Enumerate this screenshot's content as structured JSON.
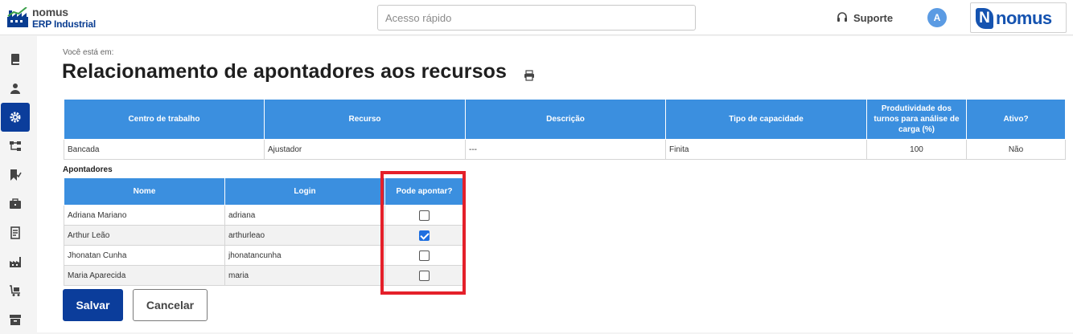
{
  "brand": {
    "name": "nomus",
    "subtitle": "ERP Industrial",
    "logo_text": "nomus"
  },
  "header": {
    "quick_access_placeholder": "Acesso rápido",
    "support_label": "Suporte",
    "avatar_initial": "A"
  },
  "sidebar": {
    "items": [
      {
        "icon": "book-icon"
      },
      {
        "icon": "user-icon"
      },
      {
        "icon": "gear-icon",
        "active": true
      },
      {
        "icon": "flow-icon"
      },
      {
        "icon": "bookmark-check-icon"
      },
      {
        "icon": "briefcase-icon"
      },
      {
        "icon": "document-icon"
      },
      {
        "icon": "factory-icon"
      },
      {
        "icon": "cart-icon"
      },
      {
        "icon": "archive-icon"
      }
    ]
  },
  "page": {
    "breadcrumb": "Você está em:",
    "title": "Relacionamento de apontadores aos recursos"
  },
  "resource_table": {
    "headers": [
      "Centro de trabalho",
      "Recurso",
      "Descrição",
      "Tipo de capacidade",
      "Produtividade dos turnos para análise de carga (%)",
      "Ativo?"
    ],
    "row": [
      "Bancada",
      "Ajustador",
      "---",
      "Finita",
      "100",
      "Não"
    ]
  },
  "pointers": {
    "section_label": "Apontadores",
    "headers": [
      "Nome",
      "Login",
      "Pode apontar?"
    ],
    "rows": [
      {
        "name": "Adriana Mariano",
        "login": "adriana",
        "checked": false
      },
      {
        "name": "Arthur Leão",
        "login": "arthurleao",
        "checked": true
      },
      {
        "name": "Jhonatan Cunha",
        "login": "jhonatancunha",
        "checked": false
      },
      {
        "name": "Maria Aparecida",
        "login": "maria",
        "checked": false
      }
    ]
  },
  "actions": {
    "save_label": "Salvar",
    "cancel_label": "Cancelar"
  },
  "colors": {
    "primary": "#0b3d9b",
    "header_blue": "#3b8fdf",
    "highlight": "#e4202a",
    "check_on": "#1e6fe0"
  }
}
